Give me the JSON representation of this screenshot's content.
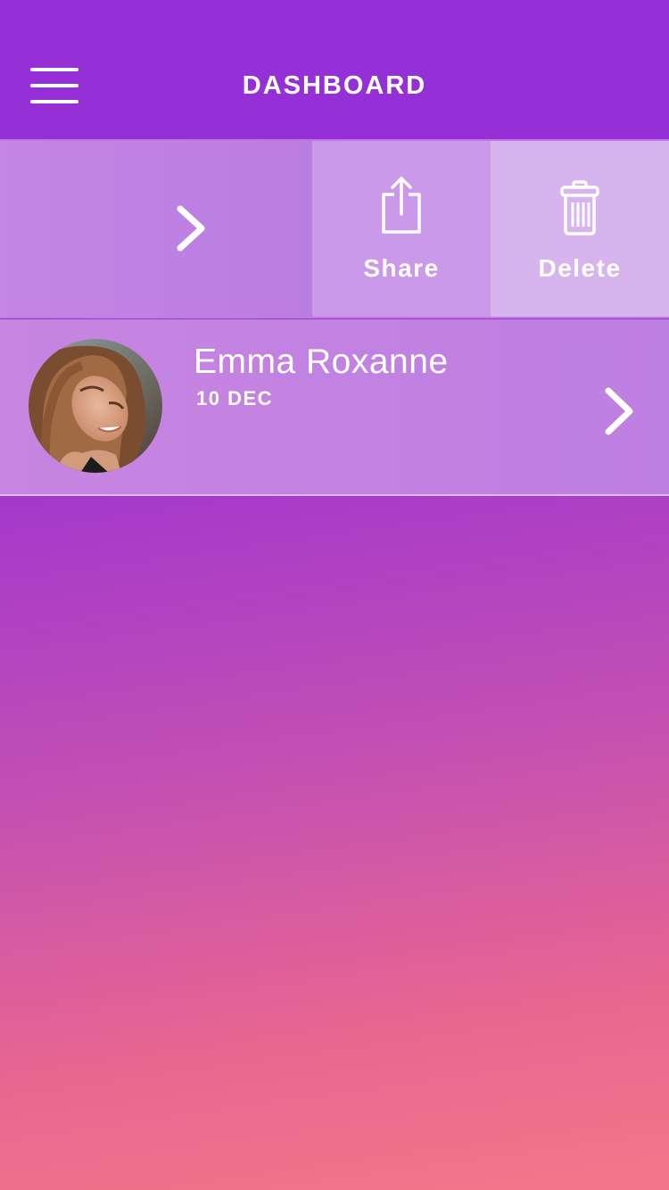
{
  "header": {
    "title": "DASHBOARD",
    "menu_icon": "hamburger-menu-icon"
  },
  "swipe_row": {
    "open_icon": "chevron-right-icon",
    "actions": {
      "share": {
        "label": "Share",
        "icon": "share-icon"
      },
      "delete": {
        "label": "Delete",
        "icon": "trash-icon"
      }
    }
  },
  "list": {
    "items": [
      {
        "name": "Emma Roxanne",
        "date": "10 DEC",
        "avatar": "profile-photo",
        "icon": "chevron-right-icon"
      }
    ]
  },
  "colors": {
    "header_bg": "#952fd6",
    "gradient_top": "#9a2fd6",
    "gradient_bottom": "#f5768a",
    "share_bg": "#cb99ea",
    "delete_bg": "#d7b4ed"
  }
}
